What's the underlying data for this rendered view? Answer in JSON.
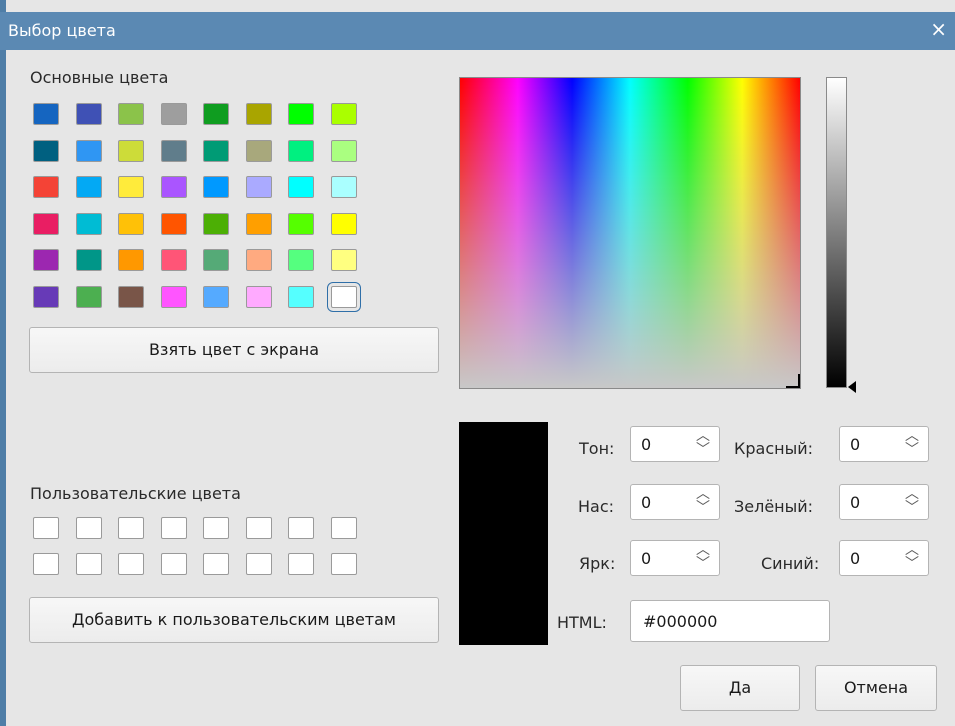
{
  "window": {
    "title": "Выбор цвета",
    "close_glyph": "×"
  },
  "basic_colors": {
    "label": "Основные цвета",
    "selected_index": 47,
    "swatches": [
      "#1565c0",
      "#3f51b5",
      "#8bc34a",
      "#9e9e9e",
      "#0f9d20",
      "#a9a500",
      "#00ff00",
      "#aaff00",
      "#006080",
      "#2f96f3",
      "#cddc39",
      "#607d8b",
      "#009b75",
      "#a8a87c",
      "#00f080",
      "#aaff80",
      "#f44336",
      "#03a9f4",
      "#ffeb3b",
      "#aa55ff",
      "#0099ff",
      "#aaaaff",
      "#00ffff",
      "#aaffff",
      "#e91e63",
      "#00bcd4",
      "#ffc107",
      "#ff5500",
      "#4caf05",
      "#ff9f00",
      "#55ff00",
      "#ffff00",
      "#9c27b0",
      "#009688",
      "#ff9800",
      "#ff5577",
      "#55aa77",
      "#ffaa80",
      "#55ff7f",
      "#ffff80",
      "#673ab7",
      "#4caf50",
      "#795548",
      "#ff55ff",
      "#55aaff",
      "#ffaaff",
      "#55ffff",
      "#ffffff"
    ]
  },
  "pick_screen_button": "Взять цвет с экрана",
  "custom_colors": {
    "label": "Пользовательские цвета",
    "swatches": [
      "#ffffff",
      "#ffffff",
      "#ffffff",
      "#ffffff",
      "#ffffff",
      "#ffffff",
      "#ffffff",
      "#ffffff",
      "#ffffff",
      "#ffffff",
      "#ffffff",
      "#ffffff",
      "#ffffff",
      "#ffffff",
      "#ffffff",
      "#ffffff"
    ]
  },
  "add_custom_button": "Добавить к пользовательским цветам",
  "fields": {
    "hue": {
      "label": "Тон:",
      "value": "0"
    },
    "sat": {
      "label": "Нас:",
      "value": "0"
    },
    "val": {
      "label": "Ярк:",
      "value": "0"
    },
    "red": {
      "label": "Красный:",
      "value": "0"
    },
    "green": {
      "label": "Зелёный:",
      "value": "0"
    },
    "blue": {
      "label": "Синий:",
      "value": "0"
    },
    "html": {
      "label": "HTML:",
      "value": "#000000"
    }
  },
  "spinner": {
    "up": "︿",
    "down": "﹀"
  },
  "ok_button": "Да",
  "cancel_button": "Отмена",
  "current_color": "#000000"
}
